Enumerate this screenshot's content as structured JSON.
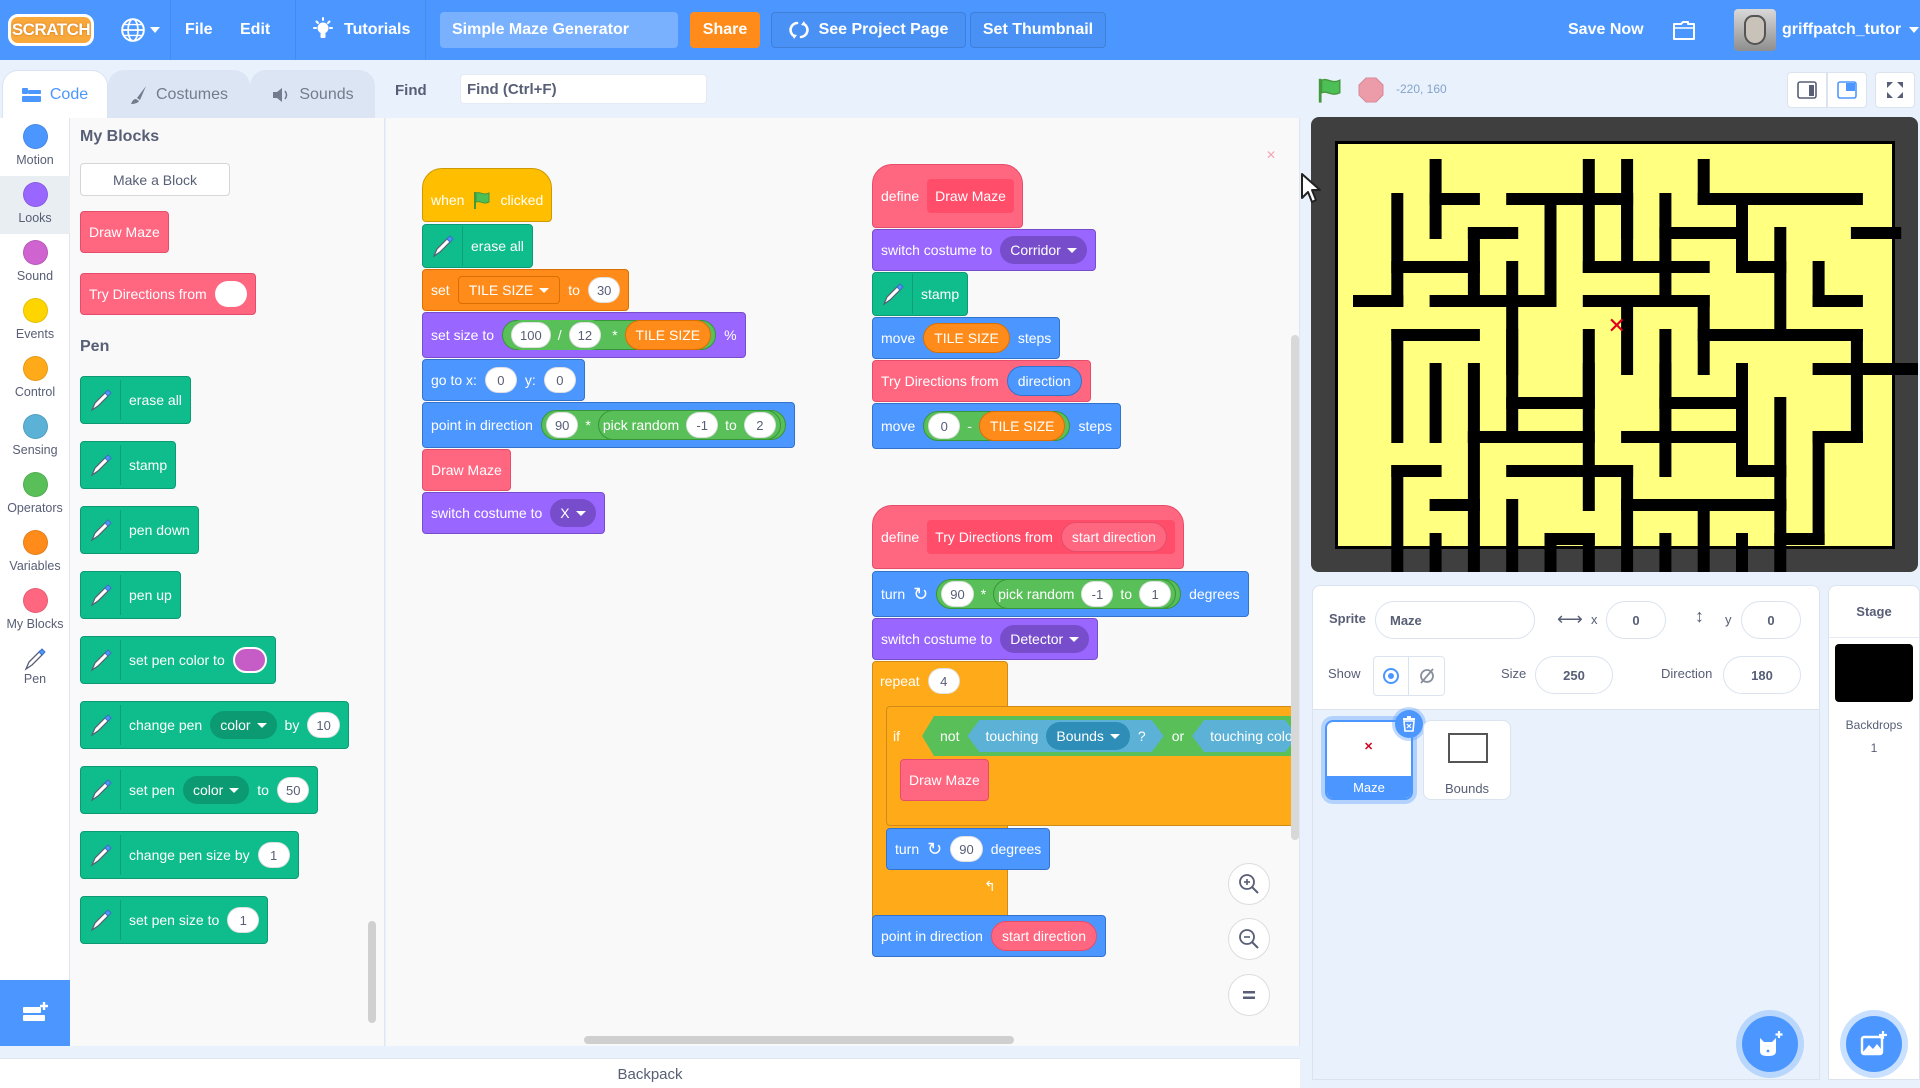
{
  "menubar": {
    "logo": "SCRATCH",
    "language_icon": "globe-icon",
    "file": "File",
    "edit": "Edit",
    "tutorials": "Tutorials",
    "project_title": "Simple Maze Generator",
    "share": "Share",
    "see_project_page": "See Project Page",
    "set_thumbnail": "Set Thumbnail",
    "save_now": "Save Now",
    "username": "griffpatch_tutor"
  },
  "tabs": [
    {
      "label": "Code",
      "active": true
    },
    {
      "label": "Costumes",
      "active": false
    },
    {
      "label": "Sounds",
      "active": false
    }
  ],
  "find": {
    "label": "Find",
    "placeholder": "Find (Ctrl+F)"
  },
  "categories": [
    {
      "label": "Motion",
      "color": "#4c97ff"
    },
    {
      "label": "Looks",
      "color": "#9966ff",
      "selected": true
    },
    {
      "label": "Sound",
      "color": "#cf63cf"
    },
    {
      "label": "Events",
      "color": "#ffd500"
    },
    {
      "label": "Control",
      "color": "#ffab19"
    },
    {
      "label": "Sensing",
      "color": "#5cb1d6"
    },
    {
      "label": "Operators",
      "color": "#59c059"
    },
    {
      "label": "Variables",
      "color": "#ff8c1a"
    },
    {
      "label": "My Blocks",
      "color": "#ff6680"
    },
    {
      "label": "Pen",
      "color": "pen"
    }
  ],
  "palette": {
    "my_blocks_heading": "My Blocks",
    "make_a_block": "Make a Block",
    "custom_blocks": [
      "Draw Maze",
      "Try Directions from"
    ],
    "pen_heading": "Pen",
    "pen_blocks": {
      "erase_all": "erase all",
      "stamp": "stamp",
      "pen_down": "pen down",
      "pen_up": "pen up",
      "set_pen_color": "set pen color to",
      "set_pen_color_value": "#c65cc6",
      "change_pen": "change pen",
      "change_pen_param": "color",
      "change_pen_by": "by",
      "change_pen_value": "10",
      "set_pen": "set pen",
      "set_pen_param": "color",
      "set_pen_to": "to",
      "set_pen_value": "50",
      "change_pen_size": "change pen size by",
      "change_pen_size_value": "1",
      "set_pen_size": "set pen size to",
      "set_pen_size_value": "1"
    }
  },
  "script1": {
    "when": "when",
    "clicked": "clicked",
    "erase_all": "erase all",
    "set": "set",
    "set_var": "TILE SIZE",
    "set_to": "to",
    "set_val": "30",
    "set_size": "set size to",
    "size_a": "100",
    "size_div": "/",
    "size_b": "12",
    "size_mul": "*",
    "size_var": "TILE SIZE",
    "size_pct": "%",
    "goto": "go to x:",
    "goto_x": "0",
    "goto_y_label": "y:",
    "goto_y": "0",
    "point": "point in direction",
    "point_a": "90",
    "point_mul": "*",
    "pick_random": "pick random",
    "pr_from": "-1",
    "pr_to_label": "to",
    "pr_to": "2",
    "draw_maze": "Draw Maze",
    "switch_costume": "switch costume to",
    "costume": "X"
  },
  "script2": {
    "define": "define",
    "proc": "Draw Maze",
    "switch_costume": "switch costume to",
    "costume": "Corridor",
    "stamp": "stamp",
    "move": "move",
    "move_var": "TILE SIZE",
    "steps": "steps",
    "try_dirs": "Try Directions from",
    "try_arg": "direction",
    "move2": "move",
    "move2_a": "0",
    "move2_op": "-",
    "move2_var": "TILE SIZE",
    "steps2": "steps"
  },
  "script3": {
    "define": "define",
    "proc": "Try Directions from",
    "param": "start direction",
    "turn": "turn",
    "turn_a": "90",
    "turn_mul": "*",
    "pick_random": "pick random",
    "pr_from": "-1",
    "pr_to_label": "to",
    "pr_to": "1",
    "degrees": "degrees",
    "switch_costume": "switch costume to",
    "costume": "Detector",
    "repeat": "repeat",
    "repeat_n": "4",
    "if": "if",
    "not": "not",
    "touching": "touching",
    "touching_obj": "Bounds",
    "q": "?",
    "or": "or",
    "touching_color": "touching color",
    "draw_maze": "Draw Maze",
    "turn2": "turn",
    "turn2_val": "90",
    "degrees2": "degrees",
    "point": "point in direction",
    "point_arg": "start direction"
  },
  "workspace": {
    "backpack": "Backpack"
  },
  "stage": {
    "mouse_coords": "-220, 160",
    "wall_color": "#000000",
    "floor_color": "#ffff80",
    "marker": "x-marker"
  },
  "sprite_info": {
    "sprite_label": "Sprite",
    "sprite_name": "Maze",
    "x_label": "x",
    "x": "0",
    "y_label": "y",
    "y": "0",
    "show_label": "Show",
    "size_label": "Size",
    "size": "250",
    "direction_label": "Direction",
    "direction": "180"
  },
  "sprites": [
    {
      "name": "Maze",
      "selected": true
    },
    {
      "name": "Bounds",
      "selected": false
    }
  ],
  "stage_panel": {
    "label": "Stage",
    "backdrops_label": "Backdrops",
    "backdrops_count": "1"
  }
}
